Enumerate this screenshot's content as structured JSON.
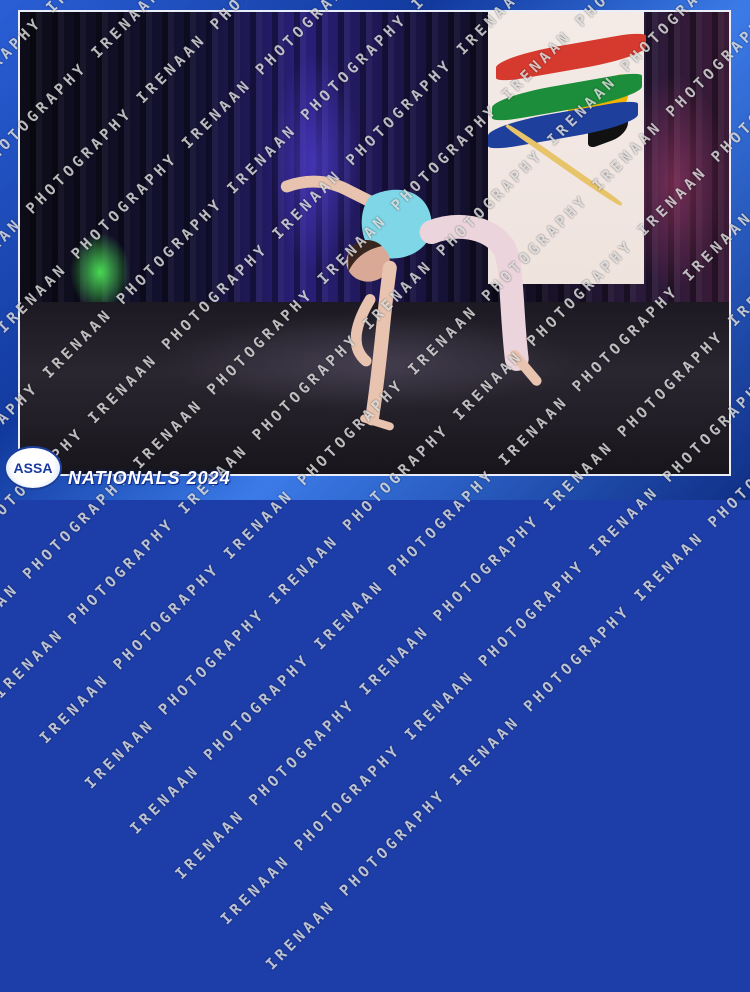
{
  "watermark": {
    "text": "IRENAAN PHOTOGRAPHY"
  },
  "branding": {
    "logo_text": "ASSA",
    "event_title": "NATIONALS 2024"
  },
  "scene": {
    "subject": "dancer",
    "banner": "south-african-flag-banner",
    "costume_color": "#7fd6e6",
    "frame_color": "#1d3ea8"
  }
}
